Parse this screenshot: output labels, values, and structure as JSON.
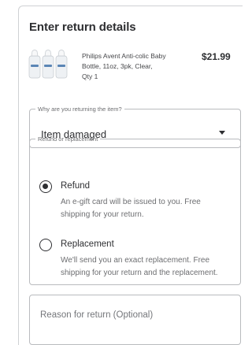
{
  "header": {
    "title": "Enter return details"
  },
  "product": {
    "image_icon": "baby-bottles-image",
    "name": "Philips Avent Anti-colic Baby Bottle, 11oz, 3pk, Clear,",
    "qty": "Qty 1",
    "price": "$21.99"
  },
  "reason_select": {
    "legend": "Why are you returning the item?",
    "value": "Item damaged",
    "icon": "caret-down-icon"
  },
  "refund_group": {
    "legend": "Refund or replacement",
    "options": [
      {
        "label": "Refund",
        "description": "An e-gift card will be issued to you. Free shipping for your return.",
        "selected": true
      },
      {
        "label": "Replacement",
        "description": "We'll send you an exact replacement. Free shipping for your return and the replacement.",
        "selected": false
      }
    ]
  },
  "reason_text": {
    "placeholder": "Reason for return (Optional)",
    "value": ""
  }
}
